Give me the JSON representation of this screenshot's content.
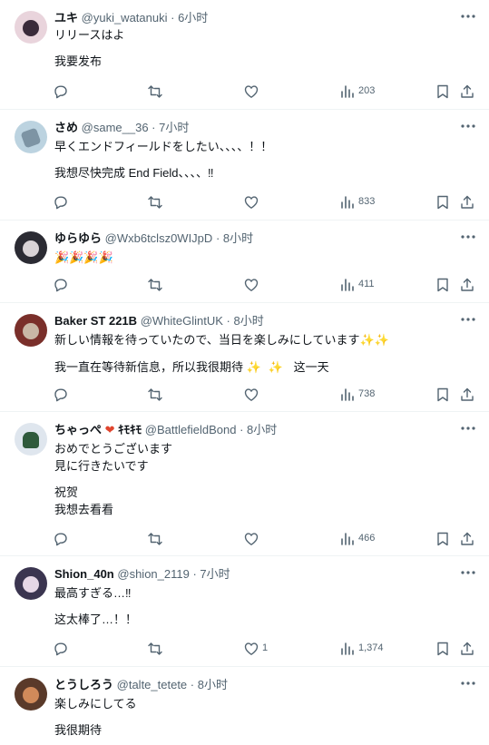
{
  "colors": {
    "text": "#0f1419",
    "secondary": "#536471",
    "divider": "#eff3f4",
    "sparkle": "#f5b800",
    "party": "#d63c3c"
  },
  "icons": {
    "more": "more-dots-icon",
    "reply": "reply-icon",
    "repost": "repost-icon",
    "like": "heart-icon",
    "views": "analytics-icon",
    "bookmark": "bookmark-icon",
    "share": "share-icon"
  },
  "tweets": [
    {
      "name": "ユキ",
      "handle": "@yuki_watanuki",
      "time": "· 6小时",
      "text": "リリースはよ",
      "translation": "我要发布",
      "likes": "",
      "views": "203"
    },
    {
      "name": "さめ",
      "handle": "@same__36",
      "time": "· 7小时",
      "text": "早くエンドフィールドをしたい、、、、！！",
      "translation": "我想尽快完成 End Field、、、、‼",
      "likes": "",
      "views": "833"
    },
    {
      "name": "ゆらゆら",
      "handle": "@Wxb6tclsz0WIJpD",
      "time": "· 8小时",
      "emoji_text": "🎉🎉🎉🎉",
      "likes": "",
      "views": "411"
    },
    {
      "name": "Baker ST 221B",
      "handle": "@WhiteGlintUK",
      "time": "· 8小时",
      "text": "新しい情報を待っていたので、当日を楽しみにしています",
      "sparkle": "✨✨",
      "translation_a": "我一直在等待新信息，所以我很期待",
      "translation_b": "这一天",
      "likes": "",
      "views": "738"
    },
    {
      "name": "ちゃっぺ",
      "name_suffix": "ｷﾓｷﾓ",
      "handle": "@BattlefieldBond",
      "time": "· 8小时",
      "text_1": "おめでとうございます",
      "text_2": "見に行きたいです",
      "translation_1": "祝贺",
      "translation_2": "我想去看看",
      "likes": "",
      "views": "466"
    },
    {
      "name": "Shion_40n",
      "handle": "@shion_2119",
      "time": "· 7小时",
      "text": "最高すぎる…‼",
      "translation": "这太棒了…！！",
      "likes": "1",
      "views": "1,374"
    },
    {
      "name": "とうしろう",
      "handle": "@talte_tetete",
      "time": "· 8小时",
      "text": "楽しみにしてる",
      "translation": "我很期待"
    }
  ]
}
